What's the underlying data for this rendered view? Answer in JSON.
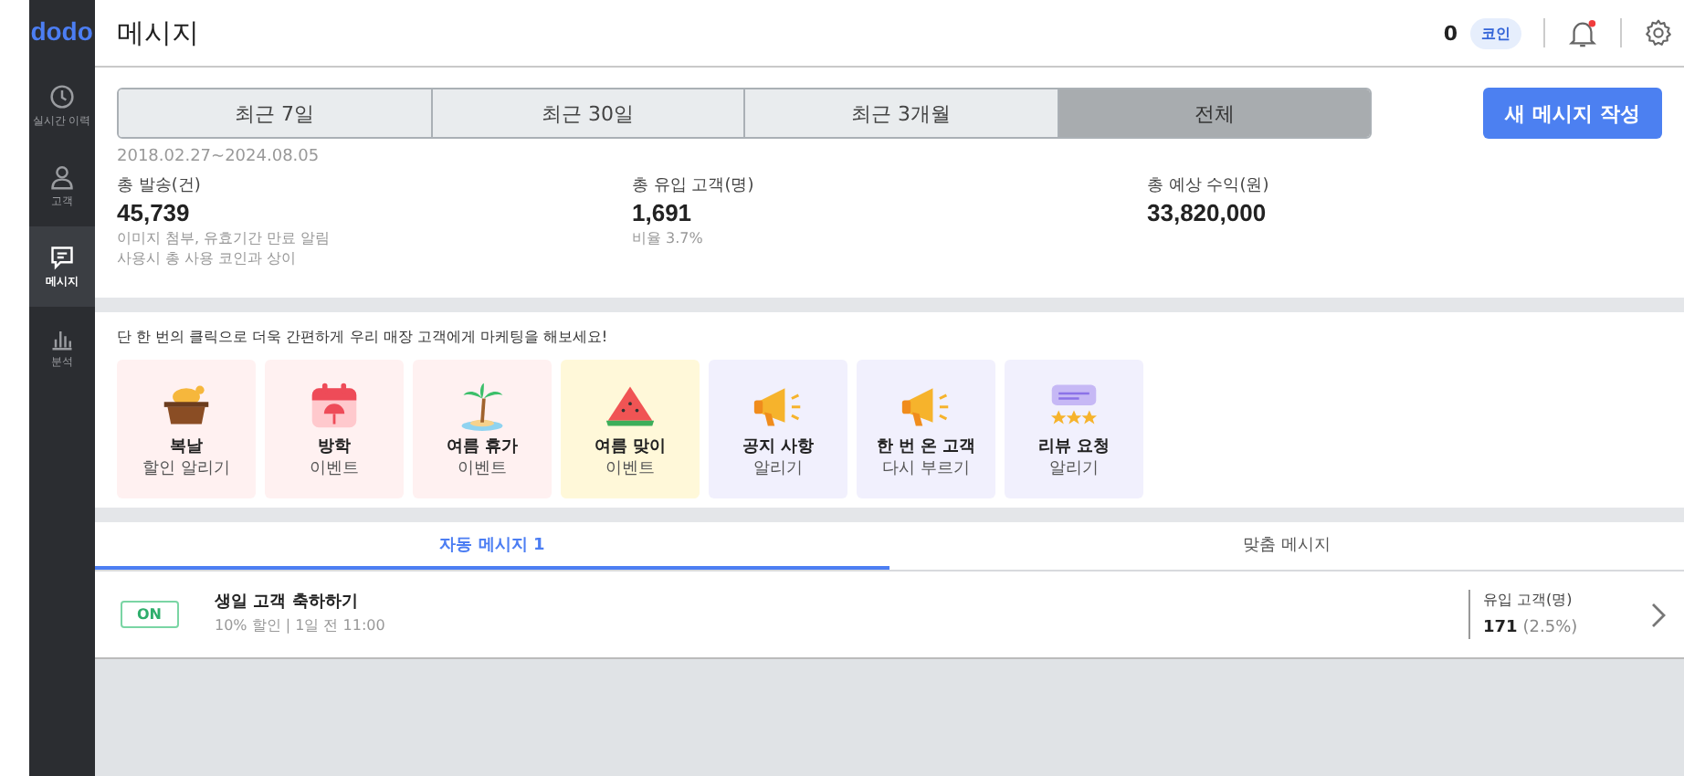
{
  "logo": "dodo",
  "sidebar": {
    "items": [
      {
        "label": "실시간 이력",
        "kind": "clock",
        "selected": false
      },
      {
        "label": "고객",
        "kind": "person",
        "selected": false
      },
      {
        "label": "메시지",
        "kind": "message",
        "selected": true
      },
      {
        "label": "분석",
        "kind": "chart",
        "selected": false
      }
    ]
  },
  "header": {
    "title": "메시지",
    "coins": "0",
    "coin_label": "코인",
    "notification_unread": true
  },
  "periods": [
    {
      "label": "최근 7일",
      "selected": false
    },
    {
      "label": "최근 30일",
      "selected": false
    },
    {
      "label": "최근 3개월",
      "selected": false
    },
    {
      "label": "전체",
      "selected": true
    }
  ],
  "new_message_button": "새 메시지 작성",
  "date_range": "2018.02.27~2024.08.05",
  "stats": [
    {
      "label": "총 발송(건)",
      "value": "45,739",
      "notes": [
        "이미지 첨부, 유효기간 만료 알림",
        "사용시 총 사용 코인과 상이"
      ]
    },
    {
      "label": "총 유입 고객(명)",
      "value": "1,691",
      "notes": [
        "비율 3.7%"
      ]
    },
    {
      "label": "총 예상 수익(원)",
      "value": "33,820,000"
    }
  ],
  "prompt": "단 한 번의 클릭으로 더욱 간편하게 우리 매장 고객에게 마케팅을 해보세요!",
  "templates": [
    {
      "title": "복날",
      "subtitle": "할인 알리기",
      "kind": "basket",
      "color": "#fff1f1"
    },
    {
      "title": "방학",
      "subtitle": "이벤트",
      "kind": "calendar",
      "color": "#fff1f1"
    },
    {
      "title": "여름 휴가",
      "subtitle": "이벤트",
      "kind": "palm",
      "color": "#fff1f1"
    },
    {
      "title": "여름 맞이",
      "subtitle": "이벤트",
      "kind": "watermelon",
      "color": "#fff8d9"
    },
    {
      "title": "공지 사항",
      "subtitle": "알리기",
      "kind": "megaphone",
      "color": "#f1f0fd"
    },
    {
      "title": "한 번 온 고객",
      "subtitle": "다시 부르기",
      "kind": "megaphone",
      "color": "#f1f0fd"
    },
    {
      "title": "리뷰 요청",
      "subtitle": "알리기",
      "kind": "review",
      "color": "#f1f0fd"
    }
  ],
  "message_tabs": [
    {
      "label": "자동 메시지 1",
      "selected": true
    },
    {
      "label": "맞춤 메시지",
      "selected": false
    }
  ],
  "messages": [
    {
      "on": true,
      "toggle_label": "ON",
      "title": "생일 고객 축하하기",
      "detail": "10% 할인 | 1일 전 11:00",
      "metric_label": "유입 고객(명)",
      "metric_value": "171",
      "metric_ratio": "(2.5%)"
    }
  ]
}
